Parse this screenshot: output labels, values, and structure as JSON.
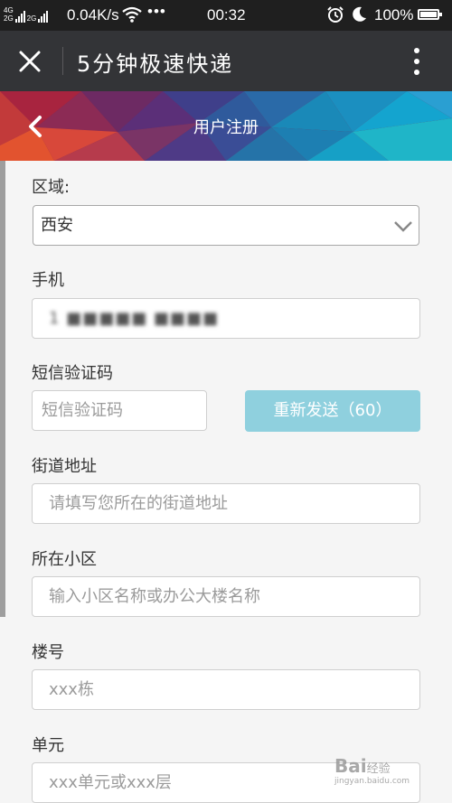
{
  "statusbar": {
    "network_top": "4G",
    "network_bottom": "2G",
    "network2_top": "2G",
    "speed": "0.04K/s",
    "more": "•••",
    "time": "00:32",
    "battery": "100%",
    "icons": [
      "signal-icon",
      "wifi-icon",
      "alarm-icon",
      "moon-icon",
      "battery-icon"
    ]
  },
  "titlebar": {
    "title": "5分钟极速快递",
    "icons": [
      "close-icon",
      "more-vert-icon"
    ]
  },
  "banner": {
    "title": "用户注册",
    "icons": [
      "back-chevron-icon"
    ]
  },
  "form": {
    "region": {
      "label": "区域:",
      "value": "西安"
    },
    "phone": {
      "label": "手机",
      "value": "1 ■■■■■ ■■■■"
    },
    "sms": {
      "label": "短信验证码",
      "placeholder": "短信验证码",
      "resend_label": "重新发送（60）"
    },
    "street": {
      "label": "街道地址",
      "placeholder": "请填写您所在的街道地址"
    },
    "community": {
      "label": "所在小区",
      "placeholder": "输入小区名称或办公大楼名称"
    },
    "building": {
      "label": "楼号",
      "placeholder": "xxx栋"
    },
    "unit": {
      "label": "单元",
      "placeholder": "xxx单元或xxx层"
    }
  },
  "watermark": {
    "brand": "Bai",
    "brand2": "经验",
    "sub": "jingyan.baidu.com"
  },
  "colors": {
    "titlebar": "#333437",
    "statusbar": "#1f1f1f",
    "resend_button": "#8fd0de",
    "background": "#f5f5f5"
  }
}
